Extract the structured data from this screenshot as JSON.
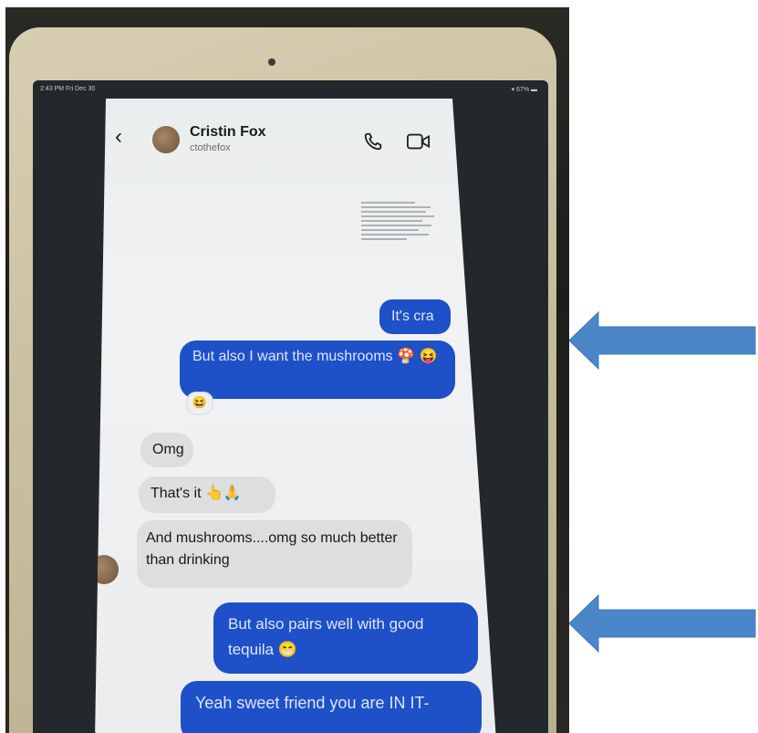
{
  "status": {
    "time": "2:43 PM  Fri Dec 30",
    "battery": "▾ 67% ▬"
  },
  "header": {
    "contact_name": "Cristin Fox",
    "contact_handle": "ctothefox",
    "icons": [
      "back-chevron-icon",
      "phone-icon",
      "video-icon"
    ]
  },
  "messages": [
    {
      "side": "out",
      "text": "It's cra"
    },
    {
      "side": "out",
      "text": "But also I want the mushrooms 🍄 😝",
      "reaction": "😆"
    },
    {
      "side": "in",
      "text": "Omg"
    },
    {
      "side": "in",
      "text": "That's it 👆🙏"
    },
    {
      "side": "in",
      "text": "And mushrooms....omg so much better than drinking"
    },
    {
      "side": "out",
      "text": "But also pairs well with good tequila 😁"
    },
    {
      "side": "out",
      "text": "Yeah sweet friend you are IN IT-"
    }
  ],
  "colors": {
    "outgoing_bubble": "#1e50c8",
    "incoming_bubble": "#dcdedf",
    "annotation_arrow": "#4a86c8"
  }
}
